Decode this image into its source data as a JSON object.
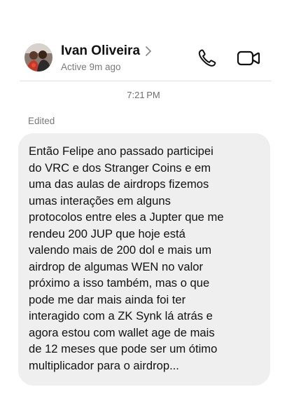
{
  "header": {
    "contact_name": "Ivan Oliveira",
    "status": "Active 9m ago",
    "avatar_icon": "user-avatar-photo",
    "chevron_icon": "chevron-right-icon",
    "call_icon": "phone-icon",
    "video_icon": "video-camera-icon"
  },
  "thread": {
    "timestamp": "7:21 PM",
    "edited_label": "Edited",
    "message": {
      "text": "Então Felipe ano passado participei\ndo VRC e dos Stranger Coins e em\numa das aulas de airdrops fizemos\numas interações em alguns\nprotocolos entre eles a Jupter que me\nrendeu 200 JUP que hoje está\nvalendo mais de 200 dol e mais um\nairdrop de algumas WEN no valor\npróximo a isso também, mas o que\npode me dar mais ainda foi ter\ninteragido com a ZK Synk lá atrás e\nagora estou com wallet age de mais\nde 12 meses que pode ser um ótimo\nmultiplicador para o airdrop...",
      "bubble_color": "#efefef"
    }
  },
  "colors": {
    "background": "#ffffff",
    "secondary_text": "#7a7a7a",
    "divider": "#e2e2e2"
  }
}
